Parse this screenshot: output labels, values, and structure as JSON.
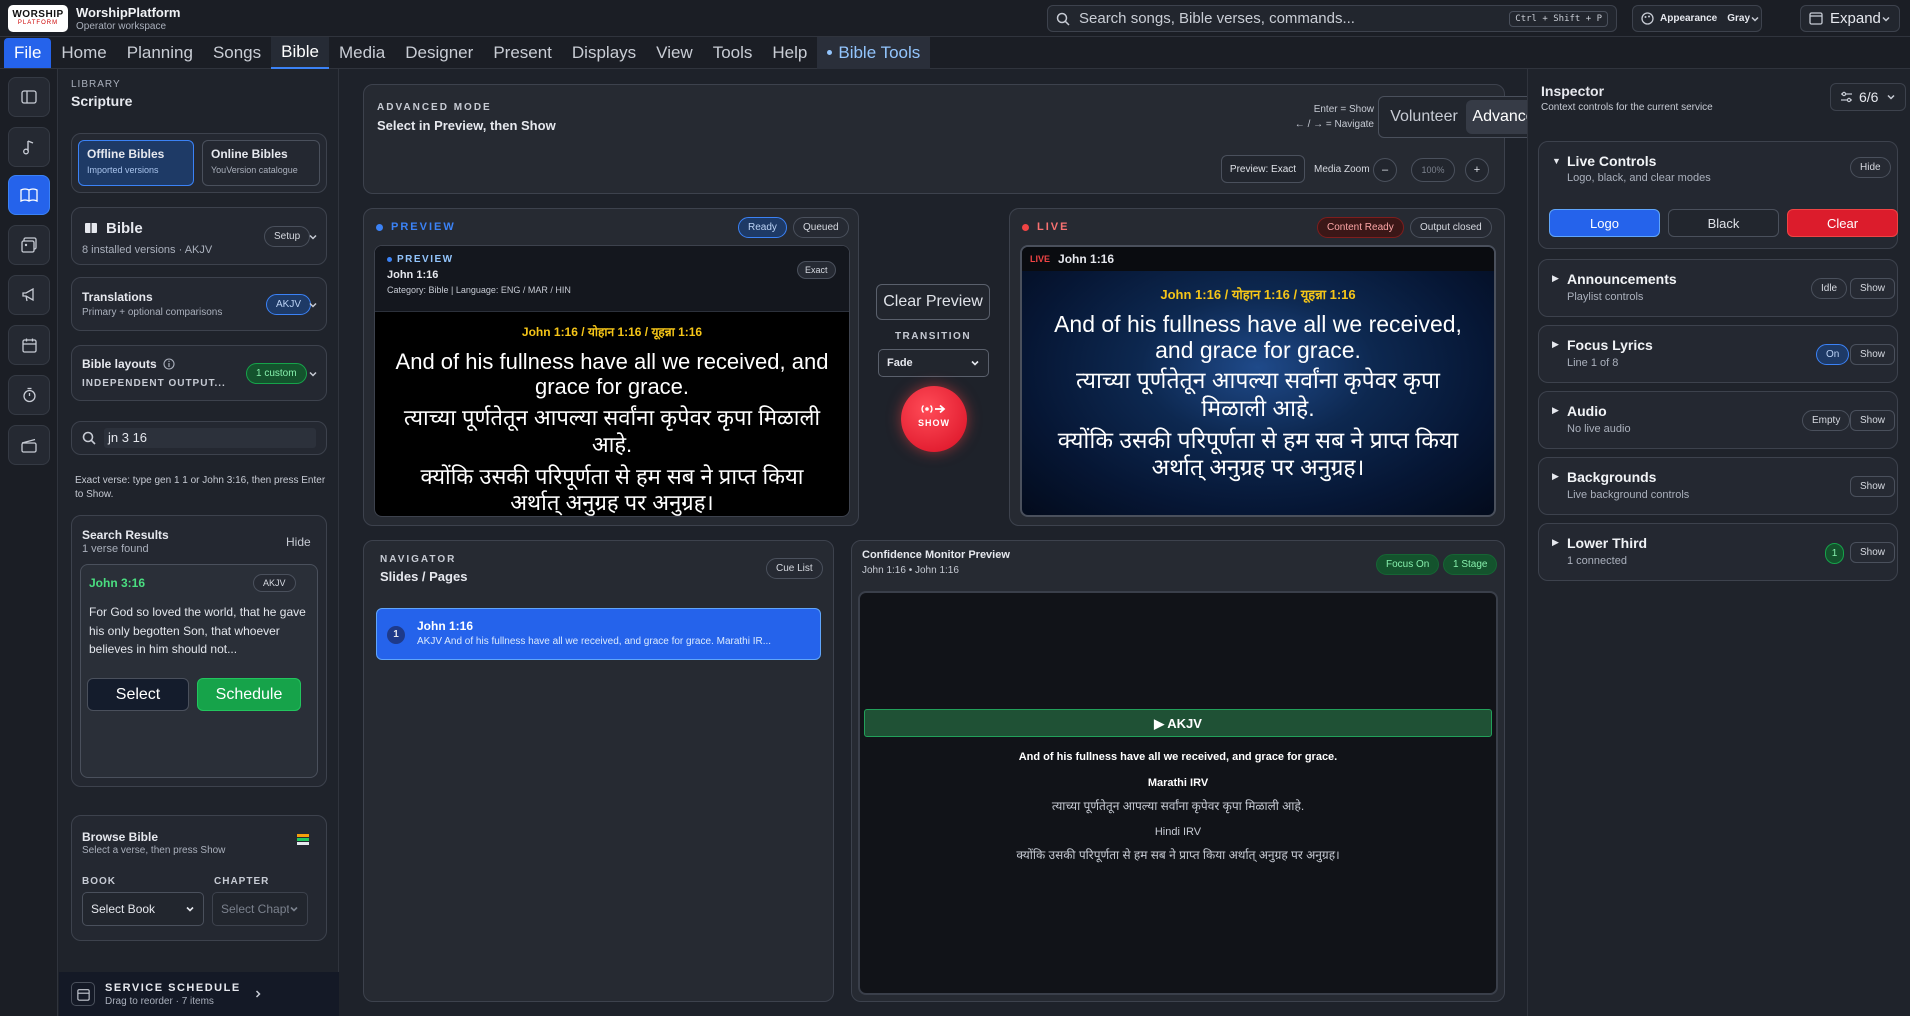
{
  "app": {
    "brand_logo_top": "WORSHIP",
    "brand_logo_bottom": "PLATFORM",
    "title": "WorshipPlatform",
    "subtitle": "Operator workspace"
  },
  "search": {
    "placeholder": "Search songs, Bible verses, commands...",
    "shortcut": "Ctrl + Shift + P"
  },
  "appearance": {
    "label": "Appearance",
    "value": "Gray"
  },
  "expand_label": "Expand",
  "menu": [
    "File",
    "Home",
    "Planning",
    "Songs",
    "Bible",
    "Media",
    "Designer",
    "Present",
    "Displays",
    "View",
    "Tools",
    "Help"
  ],
  "menu_active": "Bible",
  "menu_extra": "Bible Tools",
  "library": {
    "kicker": "LIBRARY",
    "title": "Scripture",
    "tabs": [
      {
        "title": "Offline Bibles",
        "sub": "Imported versions"
      },
      {
        "title": "Online Bibles",
        "sub": "YouVersion catalogue"
      }
    ],
    "bible": {
      "title": "Bible",
      "sub": "8 installed versions · AKJV",
      "setup": "Setup"
    },
    "translations": {
      "title": "Translations",
      "sub": "Primary + optional comparisons",
      "badge": "AKJV"
    },
    "layouts": {
      "title": "Bible layouts",
      "sub": "INDEPENDENT OUTPUT...",
      "badge": "1 custom"
    },
    "search_value": "jn 3 16",
    "hint": "Exact verse: type gen 1 1 or John 3:16, then press Enter to Show.",
    "results": {
      "title": "Search Results",
      "sub": "1 verse found",
      "hide": "Hide",
      "ref": "John 3:16",
      "version": "AKJV",
      "text": "For God so loved the world, that he gave his only begotten Son, that whoever believes in him should not...",
      "select": "Select",
      "schedule": "Schedule"
    },
    "browse": {
      "title": "Browse Bible",
      "sub": "Select a verse, then press Show",
      "book_label": "BOOK",
      "chapter_label": "CHAPTER",
      "book_value": "Select Book",
      "chapter_placeholder": "Select Chapter"
    },
    "schedule": {
      "title": "SERVICE SCHEDULE",
      "sub": "Drag to reorder · 7 items"
    }
  },
  "mode": {
    "kicker": "ADVANCED MODE",
    "title": "Select in Preview, then Show",
    "hint1": "Enter = Show",
    "hint2": "← / → = Navigate",
    "volunteer": "Volunteer",
    "advanced": "Advanced",
    "preview_exact": "Preview: Exact",
    "zoom_label": "Media Zoom",
    "zoom_value": "100%",
    "minus": "–",
    "plus": "+"
  },
  "preview": {
    "kicker": "PREVIEW",
    "ready": "Ready",
    "queued": "Queued",
    "inner_kicker": "PREVIEW",
    "ref": "John 1:16",
    "meta": "Category: Bible | Language: ENG / MAR / HIN",
    "exact": "Exact",
    "head": "John 1:16 / योहान 1:16 / यूहन्ना 1:16",
    "en": "And of his fullness have all we received, and grace for grace.",
    "mr": "त्याच्या पूर्णतेतून आपल्या सर्वांना कृपेवर कृपा मिळाली आहे.",
    "hi": "क्योंकि उसकी परिपूर्णता से हम सब ने प्राप्त किया अर्थात् अनुग्रह पर अनुग्रह।"
  },
  "transport": {
    "clear": "Clear Preview",
    "transition_label": "TRANSITION",
    "transition_value": "Fade",
    "show": "SHOW"
  },
  "live": {
    "kicker": "LIVE",
    "content_ready": "Content Ready",
    "output_closed": "Output closed",
    "tag": "LIVE",
    "ref": "John 1:16",
    "head": "John 1:16 / योहान 1:16 / यूहन्ना 1:16",
    "en": "And of his fullness have all we received, and grace for grace.",
    "mr": "त्याच्या पूर्णतेतून आपल्या सर्वांना कृपेवर कृपा मिळाली आहे.",
    "hi": "क्योंकि उसकी परिपूर्णता से हम सब ने प्राप्त किया अर्थात् अनुग्रह पर अनुग्रह।"
  },
  "navigator": {
    "kicker": "NAVIGATOR",
    "title": "Slides / Pages",
    "cue": "Cue List",
    "slides": [
      {
        "num": "1",
        "title": "John 1:16",
        "text": "AKJV And of his fullness have all we received, and grace for grace. Marathi IR..."
      }
    ]
  },
  "confidence": {
    "title": "Confidence Monitor Preview",
    "sub": "John 1:16 • John 1:16",
    "focus": "Focus On",
    "stage": "1 Stage",
    "bar": "▶ AKJV",
    "en": "And of his fullness have all we received, and grace for grace.",
    "mr_label": "Marathi IRV",
    "mr": "त्याच्या पूर्णतेतून आपल्या सर्वांना कृपेवर कृपा मिळाली आहे.",
    "hi_label": "Hindi IRV",
    "hi": "क्योंकि उसकी परिपूर्णता से हम सब ने प्राप्त किया अर्थात् अनुग्रह पर अनुग्रह।"
  },
  "inspector": {
    "title": "Inspector",
    "sub": "Context controls for the current service",
    "count": "6/6",
    "live": {
      "title": "Live Controls",
      "sub": "Logo, black, and clear modes",
      "hide": "Hide",
      "logo": "Logo",
      "black": "Black",
      "clear": "Clear"
    },
    "items": [
      {
        "title": "Announcements",
        "sub": "Playlist controls",
        "badge": "Idle",
        "action": "Show"
      },
      {
        "title": "Focus Lyrics",
        "sub": "Line 1 of 8",
        "badge": "On",
        "action": "Show"
      },
      {
        "title": "Audio",
        "sub": "No live audio",
        "badge": "Empty",
        "action": "Show"
      },
      {
        "title": "Backgrounds",
        "sub": "Live background controls",
        "badge": "",
        "action": "Show"
      },
      {
        "title": "Lower Third",
        "sub": "1 connected",
        "badge": "1",
        "action": "Show"
      }
    ]
  },
  "colors": {
    "accent": "#2563eb",
    "live_red": "#ef4444",
    "success": "#16a34a",
    "verse_yellow": "#f5c518"
  }
}
